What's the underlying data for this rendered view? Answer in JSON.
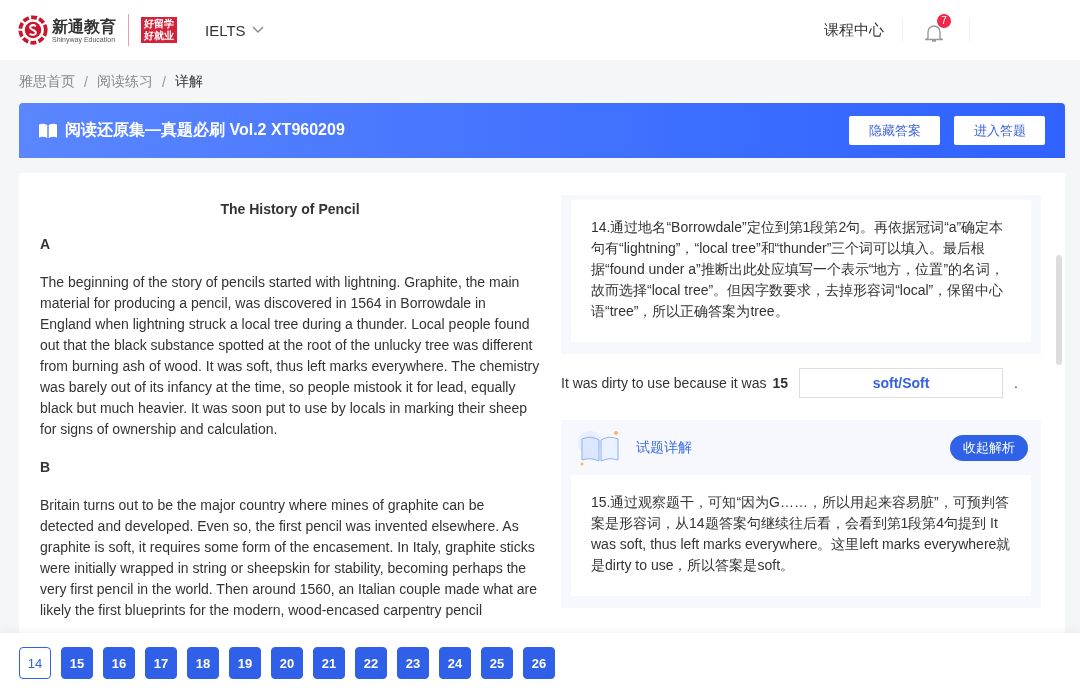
{
  "header": {
    "logo": {
      "name": "新通教育",
      "subtitle": "Shinyway Education",
      "slogan": [
        "好留学",
        "好就业"
      ]
    },
    "exam_selector": "IELTS",
    "nav_link": "课程中心",
    "notifications": {
      "badge": "7"
    }
  },
  "breadcrumb": [
    "雅思首页",
    "阅读练习",
    "详解"
  ],
  "breadcrumb_separator": "/",
  "banner": {
    "title": "阅读还原集—真题必刷 Vol.2 XT960209",
    "buttons": [
      "隐藏答案",
      "进入答题"
    ]
  },
  "passage": {
    "title": "The History of Pencil",
    "sections": [
      {
        "heading": "A",
        "paragraph": "The beginning of the story of pencils started with lightning. Graphite, the main material for producing a pencil, was discovered in 1564 in Borrowdale in England when lightning struck a local tree during a thunder. Local people found out that the black substance spotted at the root of the unlucky tree was different from burning ash of wood. It was soft, thus left marks everywhere. The chemistry was barely out of its infancy at the time, so people mistook it for lead, equally black but much heavier. It was soon put to use by locals in marking their sheep for signs of ownership and calculation."
      },
      {
        "heading": "B",
        "paragraph": "Britain turns out to be the major country where mines of graphite can be detected and developed. Even so, the first pencil was invented elsewhere. As graphite is soft, it requires some form of the encasement. In Italy, graphite sticks were initially wrapped in string or sheepskin for stability, becoming perhaps the very first pencil in the world. Then around 1560, an Italian couple made what are likely the first blueprints for the modern, wood-encased carpentry pencil"
      }
    ]
  },
  "answers": [
    {
      "kind": "analysis",
      "text": "14.通过地名“Borrowdale”定位到第1段第2句。再依据冠词“a”确定本句有“lightning”，“local tree”和“thunder”三个词可以填入。最后根据“found under a”推断出此处应填写一个表示“地方，位置”的名词，故而选择“local tree”。但因字数要求，去掉形容词“local”，保留中心语“tree”，所以正确答案为tree。"
    },
    {
      "kind": "question",
      "text": "It was dirty to use because it was",
      "number": "15",
      "answer": "soft/Soft",
      "after": "."
    },
    {
      "kind": "analysis",
      "title": "试题详解",
      "button": "收起解析",
      "text": "15.通过观察题干，可知“因为G……，所以用起来容易脏”，可预判答案是形容词，从14题答案句继续往后看，会看到第1段第4句提到 It was soft, thus left marks everywhere。这里left marks everywhere就是dirty to use，所以答案是soft。"
    }
  ],
  "question_nav": [
    {
      "label": "14",
      "selected": true
    },
    {
      "label": "15",
      "selected": false
    },
    {
      "label": "16",
      "selected": false
    },
    {
      "label": "17",
      "selected": false
    },
    {
      "label": "18",
      "selected": false
    },
    {
      "label": "19",
      "selected": false
    },
    {
      "label": "20",
      "selected": false
    },
    {
      "label": "21",
      "selected": false
    },
    {
      "label": "22",
      "selected": false
    },
    {
      "label": "23",
      "selected": false
    },
    {
      "label": "24",
      "selected": false
    },
    {
      "label": "25",
      "selected": false
    },
    {
      "label": "26",
      "selected": false
    }
  ]
}
